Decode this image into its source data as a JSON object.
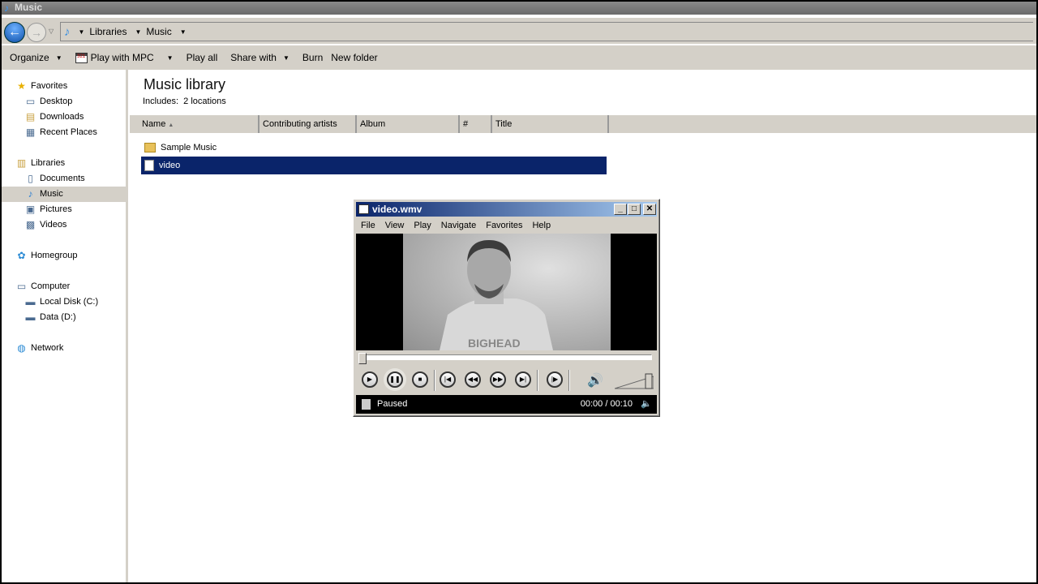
{
  "window": {
    "title": "Music"
  },
  "address": {
    "crumbs": [
      "Libraries",
      "Music"
    ]
  },
  "toolbar": {
    "organize": "Organize",
    "play_with": "Play with MPC",
    "play_all": "Play all",
    "share_with": "Share with",
    "burn": "Burn",
    "new_folder": "New folder"
  },
  "nav": {
    "items": [
      {
        "label": "Favorites",
        "icon": "star-icon",
        "indent": 0,
        "sel": false
      },
      {
        "label": "Desktop",
        "icon": "desktop-icon",
        "indent": 1,
        "sel": false
      },
      {
        "label": "Downloads",
        "icon": "downloads-icon",
        "indent": 1,
        "sel": false
      },
      {
        "label": "Recent Places",
        "icon": "recent-places-icon",
        "indent": 1,
        "sel": false
      },
      {
        "label": "Libraries",
        "icon": "libraries-icon",
        "indent": 0,
        "sel": false
      },
      {
        "label": "Documents",
        "icon": "documents-icon",
        "indent": 1,
        "sel": false
      },
      {
        "label": "Music",
        "icon": "music-icon",
        "indent": 1,
        "sel": true
      },
      {
        "label": "Pictures",
        "icon": "pictures-icon",
        "indent": 1,
        "sel": false
      },
      {
        "label": "Videos",
        "icon": "videos-icon",
        "indent": 1,
        "sel": false
      },
      {
        "label": "Homegroup",
        "icon": "homegroup-icon",
        "indent": 0,
        "sel": false
      },
      {
        "label": "Computer",
        "icon": "computer-icon",
        "indent": 0,
        "sel": false
      },
      {
        "label": "Local Disk (C:)",
        "icon": "drive-icon",
        "indent": 1,
        "sel": false
      },
      {
        "label": "Data (D:)",
        "icon": "drive-icon",
        "indent": 1,
        "sel": false
      },
      {
        "label": "Network",
        "icon": "network-icon",
        "indent": 0,
        "sel": false
      }
    ]
  },
  "library": {
    "title": "Music library",
    "includes": "Includes:",
    "locations": "2 locations"
  },
  "columns": [
    "Name",
    "Contributing artists",
    "Album",
    "#",
    "Title"
  ],
  "files": [
    {
      "name": "Sample Music",
      "type": "folder",
      "selected": false
    },
    {
      "name": "video",
      "type": "file",
      "selected": true
    }
  ],
  "player": {
    "title": "video.wmv",
    "menu": [
      "File",
      "View",
      "Play",
      "Navigate",
      "Favorites",
      "Help"
    ],
    "status": "Paused",
    "time": "00:00 / 00:10",
    "position": 0,
    "volume": 1.0
  }
}
